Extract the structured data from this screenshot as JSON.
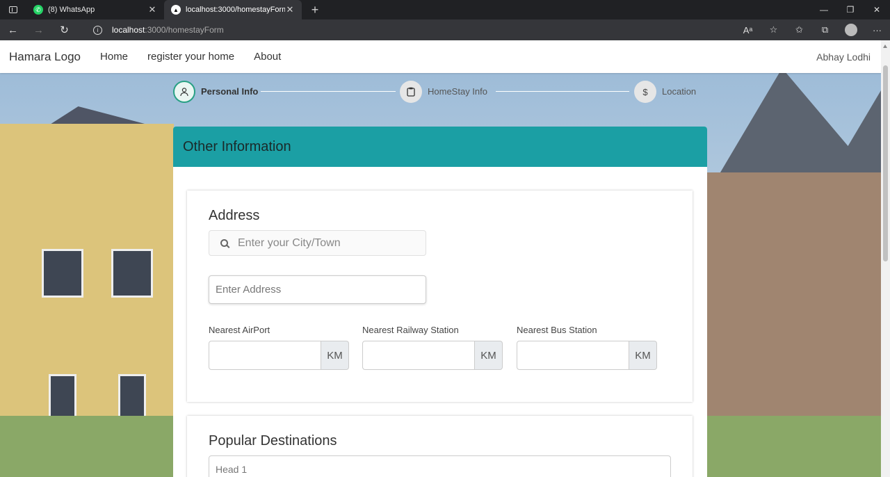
{
  "browser": {
    "tabs": [
      {
        "label": "(8) WhatsApp",
        "icon": "whatsapp-icon"
      },
      {
        "label": "localhost:3000/homestayForm",
        "icon": "app-favicon-icon"
      }
    ],
    "url_host": "localhost",
    "url_path": ":3000/homestayForm"
  },
  "nav": {
    "brand": "Hamara Logo",
    "links": [
      "Home",
      "register your home",
      "About"
    ],
    "user": "Abhay Lodhi"
  },
  "stepper": {
    "steps": [
      {
        "label": "Personal Info",
        "icon": "person-icon",
        "active": true
      },
      {
        "label": "HomeStay Info",
        "icon": "clipboard-icon",
        "active": false
      },
      {
        "label": "Location",
        "icon": "dollar-icon",
        "active": false
      }
    ]
  },
  "form": {
    "header": "Other Information",
    "address": {
      "title": "Address",
      "city_placeholder": "Enter your City/Town",
      "address_placeholder": "Enter Address",
      "distances": [
        {
          "label": "Nearest AirPort",
          "unit": "KM",
          "value": ""
        },
        {
          "label": "Nearest Railway Station",
          "unit": "KM",
          "value": ""
        },
        {
          "label": "Nearest Bus Station",
          "unit": "KM",
          "value": ""
        }
      ]
    },
    "destinations": {
      "title": "Popular Destinations",
      "head_placeholder": "Head 1"
    }
  },
  "colors": {
    "header_teal": "#1b9fa4",
    "step_active": "#28a084",
    "browser_dark": "#202124"
  }
}
